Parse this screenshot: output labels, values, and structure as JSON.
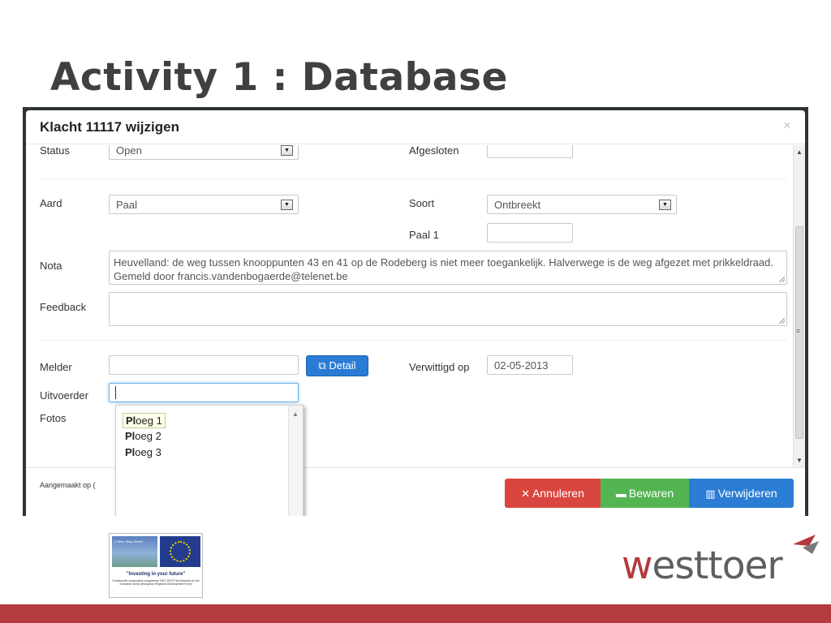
{
  "slide": {
    "title": "Activity 1 : Database"
  },
  "modal": {
    "title": "Klacht 11117 wijzigen",
    "close_glyph": "×",
    "fields": {
      "status_label": "Status",
      "status_value": "Open",
      "afgesloten_label": "Afgesloten",
      "afgesloten_value": "",
      "aard_label": "Aard",
      "aard_value": "Paal",
      "soort_label": "Soort",
      "soort_value": "Ontbreekt",
      "paal1_label": "Paal 1",
      "paal1_value": "",
      "nota_label": "Nota",
      "nota_value": "Heuvelland: de weg tussen knooppunten 43 en 41 op de Rodeberg is niet meer toegankelijk. Halverwege is de weg afgezet met prikkeldraad. Gemeld door francis.vandenbogaerde@telenet.be",
      "feedback_label": "Feedback",
      "feedback_value": "",
      "melder_label": "Melder",
      "melder_value": "",
      "detail_button": "Detail",
      "verwittigd_label": "Verwittigd op",
      "verwittigd_value": "02-05-2013",
      "uitvoerder_label": "Uitvoerder",
      "uitvoerder_value": "",
      "fotos_label": "Fotos"
    },
    "dropdown": {
      "match": "Pl",
      "items": [
        {
          "prefix": "Pl",
          "rest": "oeg 1",
          "active": true
        },
        {
          "prefix": "Pl",
          "rest": "oeg 2",
          "active": false
        },
        {
          "prefix": "Pl",
          "rest": "oeg 3",
          "active": false
        }
      ]
    },
    "footer": {
      "created_note": "Aangemaakt op (",
      "cancel": "Annuleren",
      "save": "Bewaren",
      "delete": "Verwijderen"
    }
  },
  "logos": {
    "eu_photo_text": "2 Mers Seas Zeeën",
    "eu_tagline": "\"Investing in your future\"",
    "eu_small": "Crossborder cooperation programme 2007-2013 Part-financed by the European Union (European Regional Development Fund)",
    "westtoer_w": "w",
    "westtoer_rest": "esttoer"
  },
  "colors": {
    "cancel": "#d9463f",
    "save": "#53b552",
    "delete": "#2b7dd4",
    "detail": "#2a7bd6",
    "bottom_bar": "#b43c3f"
  },
  "icons": {
    "cancel": "x-icon",
    "save": "floppy-icon",
    "delete": "trash-icon",
    "detail": "external-link-icon",
    "close": "close-icon"
  }
}
